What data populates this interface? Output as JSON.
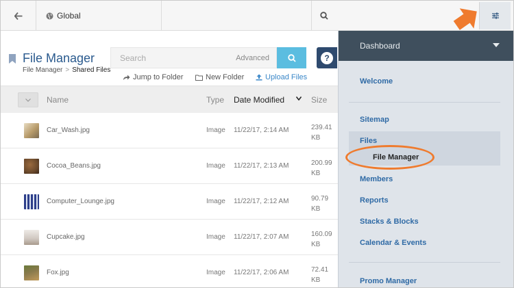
{
  "topbar": {
    "back_icon": "arrow-left-icon",
    "global_label": "Global",
    "search_icon": "search-icon",
    "settings_icon": "sliders-icon"
  },
  "file_manager": {
    "title": "File Manager",
    "breadcrumb": {
      "parent": "File Manager",
      "separator": ">",
      "current": "Shared Files"
    },
    "search": {
      "placeholder": "Search",
      "advanced_label": "Advanced"
    },
    "help_label": "?",
    "actions": {
      "jump": "Jump to Folder",
      "new_folder": "New Folder",
      "upload": "Upload Files"
    }
  },
  "table": {
    "headers": {
      "name": "Name",
      "type": "Type",
      "date": "Date Modified",
      "size": "Size"
    },
    "rows": [
      {
        "name": "Car_Wash.jpg",
        "type": "Image",
        "date": "11/22/17, 2:14 AM",
        "size_value": "239.41",
        "size_unit": "KB",
        "thumb_color": "#b79b6a"
      },
      {
        "name": "Cocoa_Beans.jpg",
        "type": "Image",
        "date": "11/22/17, 2:13 AM",
        "size_value": "200.99",
        "size_unit": "KB",
        "thumb_color": "#6b4a2c"
      },
      {
        "name": "Computer_Lounge.jpg",
        "type": "Image",
        "date": "11/22/17, 2:12 AM",
        "size_value": "90.79",
        "size_unit": "KB",
        "thumb_color": "#2d3e8a"
      },
      {
        "name": "Cupcake.jpg",
        "type": "Image",
        "date": "11/22/17, 2:07 AM",
        "size_value": "160.09",
        "size_unit": "KB",
        "thumb_color": "#cfc7c0"
      },
      {
        "name": "Fox.jpg",
        "type": "Image",
        "date": "11/22/17, 2:06 AM",
        "size_value": "72.41",
        "size_unit": "KB",
        "thumb_color": "#8a7a4c"
      }
    ]
  },
  "dashboard": {
    "title": "Dashboard",
    "items": {
      "welcome": "Welcome",
      "sitemap": "Sitemap",
      "files": "Files",
      "file_manager": "File Manager",
      "members": "Members",
      "reports": "Reports",
      "stacks": "Stacks & Blocks",
      "calendar": "Calendar & Events",
      "promo": "Promo Manager"
    }
  },
  "colors": {
    "accent_orange": "#ef7b2e",
    "link_blue": "#2f6aa5",
    "panel_bg": "#dfe4ea",
    "panel_header": "#3f4f5d",
    "search_button": "#5bbde0"
  }
}
